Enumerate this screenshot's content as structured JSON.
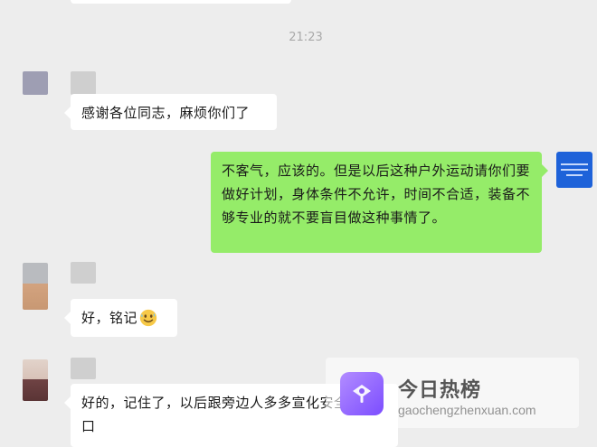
{
  "chat": {
    "timestamp": "21:23",
    "messages": [
      {
        "direction": "incoming",
        "text": "感谢各位同志，麻烦你们了"
      },
      {
        "direction": "outgoing",
        "text": "不客气，应该的。但是以后这种户外运动请你们要做好计划，身体条件不允许，时间不合适，装备不够专业的就不要盲目做这种事情了。"
      },
      {
        "direction": "incoming",
        "text": "好，铭记"
      },
      {
        "direction": "incoming",
        "text": "好的，记住了，以后跟旁边人多多宣化安全知识口"
      }
    ]
  },
  "watermark": {
    "brand": "今日热榜",
    "url": "gaochengzhenxuan.com"
  },
  "icons": {
    "emoji": "grinning-sweat-face-icon",
    "watermark_logo": "watermark-logo-icon"
  },
  "colors": {
    "background": "#ededed",
    "outgoing_bubble": "#95ec69",
    "incoming_bubble": "#ffffff",
    "timestamp_text": "#a9a9a9",
    "watermark_logo": "#8b5cf6"
  }
}
